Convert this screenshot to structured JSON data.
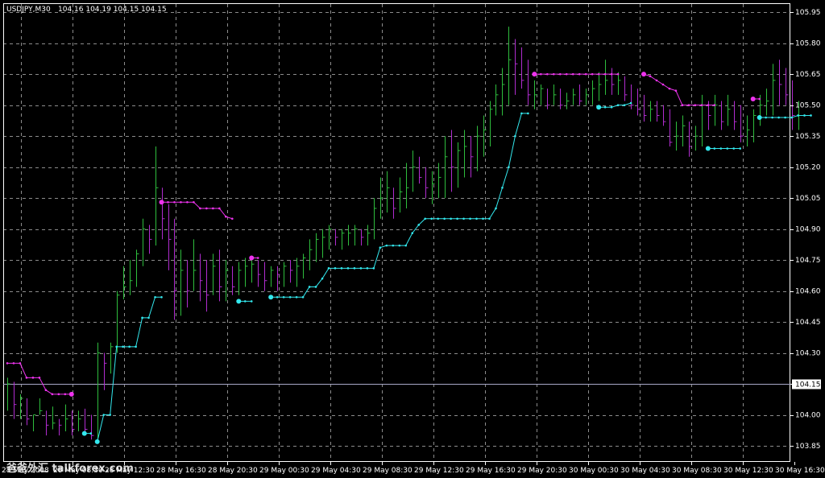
{
  "header": {
    "symbol_tf": "USDJPY,M30",
    "ohlc": "104.16 104.19 104.15 104.15"
  },
  "watermark": "爸爸外汇 talkforex.com",
  "colors": {
    "background": "#000000",
    "grid": "#8c8c8c",
    "frame": "#ffffff",
    "bull": "#2ebd3d",
    "bear": "#b02ccf",
    "stop_up": "#33e8ee",
    "stop_down": "#ee33ee",
    "current_line": "#a8a8c8"
  },
  "chart_data": {
    "type": "bar",
    "title": "USDJPY,M30",
    "ylim": [
      103.8,
      105.98
    ],
    "yticks": [
      "105.95",
      "105.80",
      "105.65",
      "105.50",
      "105.35",
      "105.20",
      "105.05",
      "104.90",
      "104.75",
      "104.60",
      "104.45",
      "104.30",
      "104.15",
      "104.00",
      "103.85"
    ],
    "ytick_values": [
      105.95,
      105.8,
      105.65,
      105.5,
      105.35,
      105.2,
      105.05,
      104.9,
      104.75,
      104.6,
      104.45,
      104.3,
      104.15,
      104.0,
      103.85
    ],
    "xticks": [
      "28 May 2008",
      "28 May 08:30",
      "28 May 12:30",
      "28 May 16:30",
      "28 May 20:30",
      "29 May 00:30",
      "29 May 04:30",
      "29 May 08:30",
      "29 May 12:30",
      "29 May 16:30",
      "29 May 20:30",
      "30 May 00:30",
      "30 May 04:30",
      "30 May 08:30",
      "30 May 12:30",
      "30 May 16:30"
    ],
    "current_price": 104.15,
    "current_price_label": "104.15",
    "bars": [
      {
        "h": 104.18,
        "l": 104.02,
        "c": 104.15
      },
      {
        "h": 104.16,
        "l": 103.98,
        "c": 104.05
      },
      {
        "h": 104.1,
        "l": 103.98,
        "c": 104.08
      },
      {
        "h": 104.08,
        "l": 103.95,
        "c": 103.98
      },
      {
        "h": 104.0,
        "l": 103.92,
        "c": 104.0
      },
      {
        "h": 104.08,
        "l": 104.0,
        "c": 104.02
      },
      {
        "h": 104.02,
        "l": 103.9,
        "c": 103.95
      },
      {
        "h": 104.04,
        "l": 103.93,
        "c": 103.96
      },
      {
        "h": 103.98,
        "l": 103.9,
        "c": 103.95
      },
      {
        "h": 104.05,
        "l": 103.92,
        "c": 103.98
      },
      {
        "h": 104.02,
        "l": 103.9,
        "c": 103.93
      },
      {
        "h": 104.02,
        "l": 103.92,
        "c": 103.98
      },
      {
        "h": 104.03,
        "l": 103.92,
        "c": 103.93
      },
      {
        "h": 104.0,
        "l": 103.88,
        "c": 103.9
      },
      {
        "h": 104.35,
        "l": 103.86,
        "c": 104.3
      },
      {
        "h": 104.3,
        "l": 104.12,
        "c": 104.25
      },
      {
        "h": 104.35,
        "l": 104.2,
        "c": 104.33
      },
      {
        "h": 104.6,
        "l": 104.3,
        "c": 104.58
      },
      {
        "h": 104.72,
        "l": 104.56,
        "c": 104.62
      },
      {
        "h": 104.75,
        "l": 104.58,
        "c": 104.65
      },
      {
        "h": 104.8,
        "l": 104.62,
        "c": 104.78
      },
      {
        "h": 104.95,
        "l": 104.72,
        "c": 104.9
      },
      {
        "h": 104.92,
        "l": 104.78,
        "c": 104.85
      },
      {
        "h": 105.3,
        "l": 104.82,
        "c": 105.1
      },
      {
        "h": 105.1,
        "l": 104.85,
        "c": 104.95
      },
      {
        "h": 105.02,
        "l": 104.7,
        "c": 104.85
      },
      {
        "h": 104.95,
        "l": 104.46,
        "c": 104.6
      },
      {
        "h": 104.8,
        "l": 104.48,
        "c": 104.7
      },
      {
        "h": 104.75,
        "l": 104.52,
        "c": 104.6
      },
      {
        "h": 104.85,
        "l": 104.6,
        "c": 104.7
      },
      {
        "h": 104.78,
        "l": 104.55,
        "c": 104.65
      },
      {
        "h": 104.75,
        "l": 104.5,
        "c": 104.58
      },
      {
        "h": 104.78,
        "l": 104.58,
        "c": 104.72
      },
      {
        "h": 104.8,
        "l": 104.55,
        "c": 104.62
      },
      {
        "h": 104.75,
        "l": 104.55,
        "c": 104.7
      },
      {
        "h": 104.72,
        "l": 104.58,
        "c": 104.62
      },
      {
        "h": 104.74,
        "l": 104.58,
        "c": 104.7
      },
      {
        "h": 104.76,
        "l": 104.62,
        "c": 104.72
      },
      {
        "h": 104.75,
        "l": 104.64,
        "c": 104.73
      },
      {
        "h": 104.75,
        "l": 104.62,
        "c": 104.68
      },
      {
        "h": 104.74,
        "l": 104.6,
        "c": 104.65
      },
      {
        "h": 104.72,
        "l": 104.62,
        "c": 104.7
      },
      {
        "h": 104.72,
        "l": 104.6,
        "c": 104.68
      },
      {
        "h": 104.74,
        "l": 104.62,
        "c": 104.72
      },
      {
        "h": 104.75,
        "l": 104.64,
        "c": 104.7
      },
      {
        "h": 104.76,
        "l": 104.62,
        "c": 104.72
      },
      {
        "h": 104.78,
        "l": 104.66,
        "c": 104.76
      },
      {
        "h": 104.85,
        "l": 104.7,
        "c": 104.8
      },
      {
        "h": 104.88,
        "l": 104.74,
        "c": 104.85
      },
      {
        "h": 104.9,
        "l": 104.76,
        "c": 104.86
      },
      {
        "h": 104.92,
        "l": 104.8,
        "c": 104.9
      },
      {
        "h": 104.9,
        "l": 104.82,
        "c": 104.86
      },
      {
        "h": 104.9,
        "l": 104.8,
        "c": 104.88
      },
      {
        "h": 104.92,
        "l": 104.82,
        "c": 104.88
      },
      {
        "h": 104.92,
        "l": 104.82,
        "c": 104.9
      },
      {
        "h": 104.9,
        "l": 104.82,
        "c": 104.86
      },
      {
        "h": 104.92,
        "l": 104.82,
        "c": 104.88
      },
      {
        "h": 105.05,
        "l": 104.85,
        "c": 105.0
      },
      {
        "h": 105.15,
        "l": 104.95,
        "c": 105.05
      },
      {
        "h": 105.18,
        "l": 104.98,
        "c": 105.1
      },
      {
        "h": 105.1,
        "l": 104.95,
        "c": 105.0
      },
      {
        "h": 105.15,
        "l": 104.98,
        "c": 105.08
      },
      {
        "h": 105.22,
        "l": 105.0,
        "c": 105.1
      },
      {
        "h": 105.28,
        "l": 105.08,
        "c": 105.2
      },
      {
        "h": 105.25,
        "l": 105.12,
        "c": 105.15
      },
      {
        "h": 105.2,
        "l": 105.05,
        "c": 105.1
      },
      {
        "h": 105.18,
        "l": 105.02,
        "c": 105.12
      },
      {
        "h": 105.22,
        "l": 105.05,
        "c": 105.15
      },
      {
        "h": 105.35,
        "l": 105.05,
        "c": 105.25
      },
      {
        "h": 105.38,
        "l": 105.08,
        "c": 105.2
      },
      {
        "h": 105.32,
        "l": 105.1,
        "c": 105.28
      },
      {
        "h": 105.38,
        "l": 105.15,
        "c": 105.3
      },
      {
        "h": 105.35,
        "l": 105.15,
        "c": 105.25
      },
      {
        "h": 105.4,
        "l": 105.18,
        "c": 105.35
      },
      {
        "h": 105.45,
        "l": 105.25,
        "c": 105.38
      },
      {
        "h": 105.52,
        "l": 105.3,
        "c": 105.48
      },
      {
        "h": 105.6,
        "l": 105.45,
        "c": 105.55
      },
      {
        "h": 105.68,
        "l": 105.45,
        "c": 105.6
      },
      {
        "h": 105.88,
        "l": 105.5,
        "c": 105.72
      },
      {
        "h": 105.82,
        "l": 105.55,
        "c": 105.7
      },
      {
        "h": 105.78,
        "l": 105.58,
        "c": 105.62
      },
      {
        "h": 105.72,
        "l": 105.5,
        "c": 105.55
      },
      {
        "h": 105.62,
        "l": 105.48,
        "c": 105.55
      },
      {
        "h": 105.6,
        "l": 105.5,
        "c": 105.58
      },
      {
        "h": 105.58,
        "l": 105.48,
        "c": 105.5
      },
      {
        "h": 105.6,
        "l": 105.5,
        "c": 105.55
      },
      {
        "h": 105.58,
        "l": 105.48,
        "c": 105.5
      },
      {
        "h": 105.56,
        "l": 105.48,
        "c": 105.52
      },
      {
        "h": 105.58,
        "l": 105.5,
        "c": 105.55
      },
      {
        "h": 105.6,
        "l": 105.5,
        "c": 105.52
      },
      {
        "h": 105.58,
        "l": 105.5,
        "c": 105.55
      },
      {
        "h": 105.62,
        "l": 105.5,
        "c": 105.58
      },
      {
        "h": 105.66,
        "l": 105.52,
        "c": 105.6
      },
      {
        "h": 105.72,
        "l": 105.55,
        "c": 105.62
      },
      {
        "h": 105.68,
        "l": 105.55,
        "c": 105.6
      },
      {
        "h": 105.66,
        "l": 105.55,
        "c": 105.62
      },
      {
        "h": 105.64,
        "l": 105.52,
        "c": 105.55
      },
      {
        "h": 105.6,
        "l": 105.48,
        "c": 105.5
      },
      {
        "h": 105.58,
        "l": 105.45,
        "c": 105.48
      },
      {
        "h": 105.55,
        "l": 105.42,
        "c": 105.45
      },
      {
        "h": 105.52,
        "l": 105.42,
        "c": 105.48
      },
      {
        "h": 105.52,
        "l": 105.42,
        "c": 105.45
      },
      {
        "h": 105.5,
        "l": 105.4,
        "c": 105.42
      },
      {
        "h": 105.48,
        "l": 105.3,
        "c": 105.32
      },
      {
        "h": 105.42,
        "l": 105.28,
        "c": 105.35
      },
      {
        "h": 105.45,
        "l": 105.3,
        "c": 105.4
      },
      {
        "h": 105.42,
        "l": 105.25,
        "c": 105.3
      },
      {
        "h": 105.4,
        "l": 105.28,
        "c": 105.35
      },
      {
        "h": 105.55,
        "l": 105.3,
        "c": 105.5
      },
      {
        "h": 105.52,
        "l": 105.38,
        "c": 105.45
      },
      {
        "h": 105.55,
        "l": 105.4,
        "c": 105.5
      },
      {
        "h": 105.52,
        "l": 105.38,
        "c": 105.42
      },
      {
        "h": 105.55,
        "l": 105.4,
        "c": 105.48
      },
      {
        "h": 105.52,
        "l": 105.38,
        "c": 105.42
      },
      {
        "h": 105.5,
        "l": 105.32,
        "c": 105.35
      },
      {
        "h": 105.45,
        "l": 105.3,
        "c": 105.38
      },
      {
        "h": 105.48,
        "l": 105.32,
        "c": 105.45
      },
      {
        "h": 105.55,
        "l": 105.4,
        "c": 105.5
      },
      {
        "h": 105.58,
        "l": 105.45,
        "c": 105.52
      },
      {
        "h": 105.7,
        "l": 105.45,
        "c": 105.62
      },
      {
        "h": 105.72,
        "l": 105.5,
        "c": 105.6
      },
      {
        "h": 105.68,
        "l": 105.5,
        "c": 105.55
      },
      {
        "h": 105.62,
        "l": 105.38,
        "c": 105.45
      },
      {
        "h": 105.52,
        "l": 105.38,
        "c": 105.45
      }
    ],
    "stop_down_segments": [
      {
        "from": 0,
        "to": 10,
        "values": [
          104.25,
          104.25,
          104.25,
          104.18,
          104.18,
          104.18,
          104.12,
          104.1,
          104.1,
          104.1,
          104.1
        ]
      },
      {
        "from": 24,
        "to": 35,
        "values": [
          105.03,
          105.03,
          105.03,
          105.03,
          105.03,
          105.03,
          105.0,
          105.0,
          105.0,
          105.0,
          104.96,
          104.95
        ]
      },
      {
        "from": 38,
        "to": 39,
        "values": [
          104.76,
          104.76
        ]
      },
      {
        "from": 82,
        "to": 95,
        "values": [
          105.65,
          105.65,
          105.65,
          105.65,
          105.65,
          105.65,
          105.65,
          105.65,
          105.65,
          105.65,
          105.65,
          105.65,
          105.65,
          105.65
        ]
      },
      {
        "from": 99,
        "to": 105,
        "values": [
          105.65,
          105.64,
          105.62,
          105.6,
          105.58,
          105.57,
          105.5
        ]
      },
      {
        "from": 105,
        "to": 110,
        "values": [
          105.5,
          105.5,
          105.5,
          105.5,
          105.5,
          105.5
        ]
      },
      {
        "from": 116,
        "to": 117,
        "values": [
          105.53,
          105.53
        ]
      }
    ],
    "stop_up_segments": [
      {
        "from": 12,
        "to": 13,
        "values": [
          103.91,
          103.91
        ]
      },
      {
        "from": 14,
        "to": 21,
        "values": [
          103.87,
          104.0,
          104.0,
          104.33,
          104.33,
          104.33,
          104.33,
          104.47
        ]
      },
      {
        "from": 21,
        "to": 24,
        "values": [
          104.47,
          104.47,
          104.57,
          104.57
        ]
      },
      {
        "from": 36,
        "to": 38,
        "values": [
          104.55,
          104.55,
          104.55
        ]
      },
      {
        "from": 41,
        "to": 81,
        "values": [
          104.57,
          104.57,
          104.57,
          104.57,
          104.57,
          104.57,
          104.62,
          104.62,
          104.66,
          104.71,
          104.71,
          104.71,
          104.71,
          104.71,
          104.71,
          104.71,
          104.71,
          104.81,
          104.82,
          104.82,
          104.82,
          104.82,
          104.88,
          104.92,
          104.95,
          104.95,
          104.95,
          104.95,
          104.95,
          104.95,
          104.95,
          104.95,
          104.95,
          104.95,
          104.95,
          105.0,
          105.1,
          105.2,
          105.35,
          105.46,
          105.46
        ]
      },
      {
        "from": 92,
        "to": 97,
        "values": [
          105.49,
          105.49,
          105.49,
          105.5,
          105.5,
          105.51
        ]
      },
      {
        "from": 109,
        "to": 114,
        "values": [
          105.29,
          105.29,
          105.29,
          105.29,
          105.29,
          105.29
        ]
      },
      {
        "from": 117,
        "to": 125,
        "values": [
          105.44,
          105.44,
          105.44,
          105.44,
          105.44,
          105.44,
          105.45,
          105.45,
          105.45
        ]
      }
    ],
    "stop_up_signals": [
      12,
      14,
      36,
      41,
      92,
      109,
      117
    ],
    "stop_down_signals": [
      10,
      24,
      38,
      82,
      99,
      116
    ]
  }
}
